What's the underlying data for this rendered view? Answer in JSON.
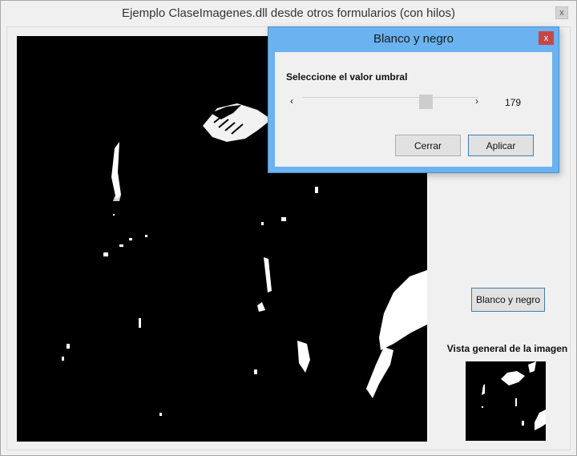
{
  "main_window": {
    "title": "Ejemplo ClaseImagenes.dll desde otros formularios (con hilos)",
    "close_glyph": "x"
  },
  "right_panel": {
    "bn_button_label": "Blanco y negro",
    "overview_label": "Vista general de la imagen"
  },
  "dialog": {
    "title": "Blanco y negro",
    "close_glyph": "x",
    "threshold_label": "Seleccione el valor umbral",
    "threshold_value": "179",
    "threshold_min": 0,
    "threshold_max": 255,
    "slider_left_glyph": "‹",
    "slider_right_glyph": "›",
    "cancel_label": "Cerrar",
    "apply_label": "Aplicar"
  },
  "colors": {
    "dialog_frame": "#6ab2f0",
    "dialog_close": "#c74747",
    "image_background": "#000000",
    "image_foreground": "#ffffff"
  }
}
